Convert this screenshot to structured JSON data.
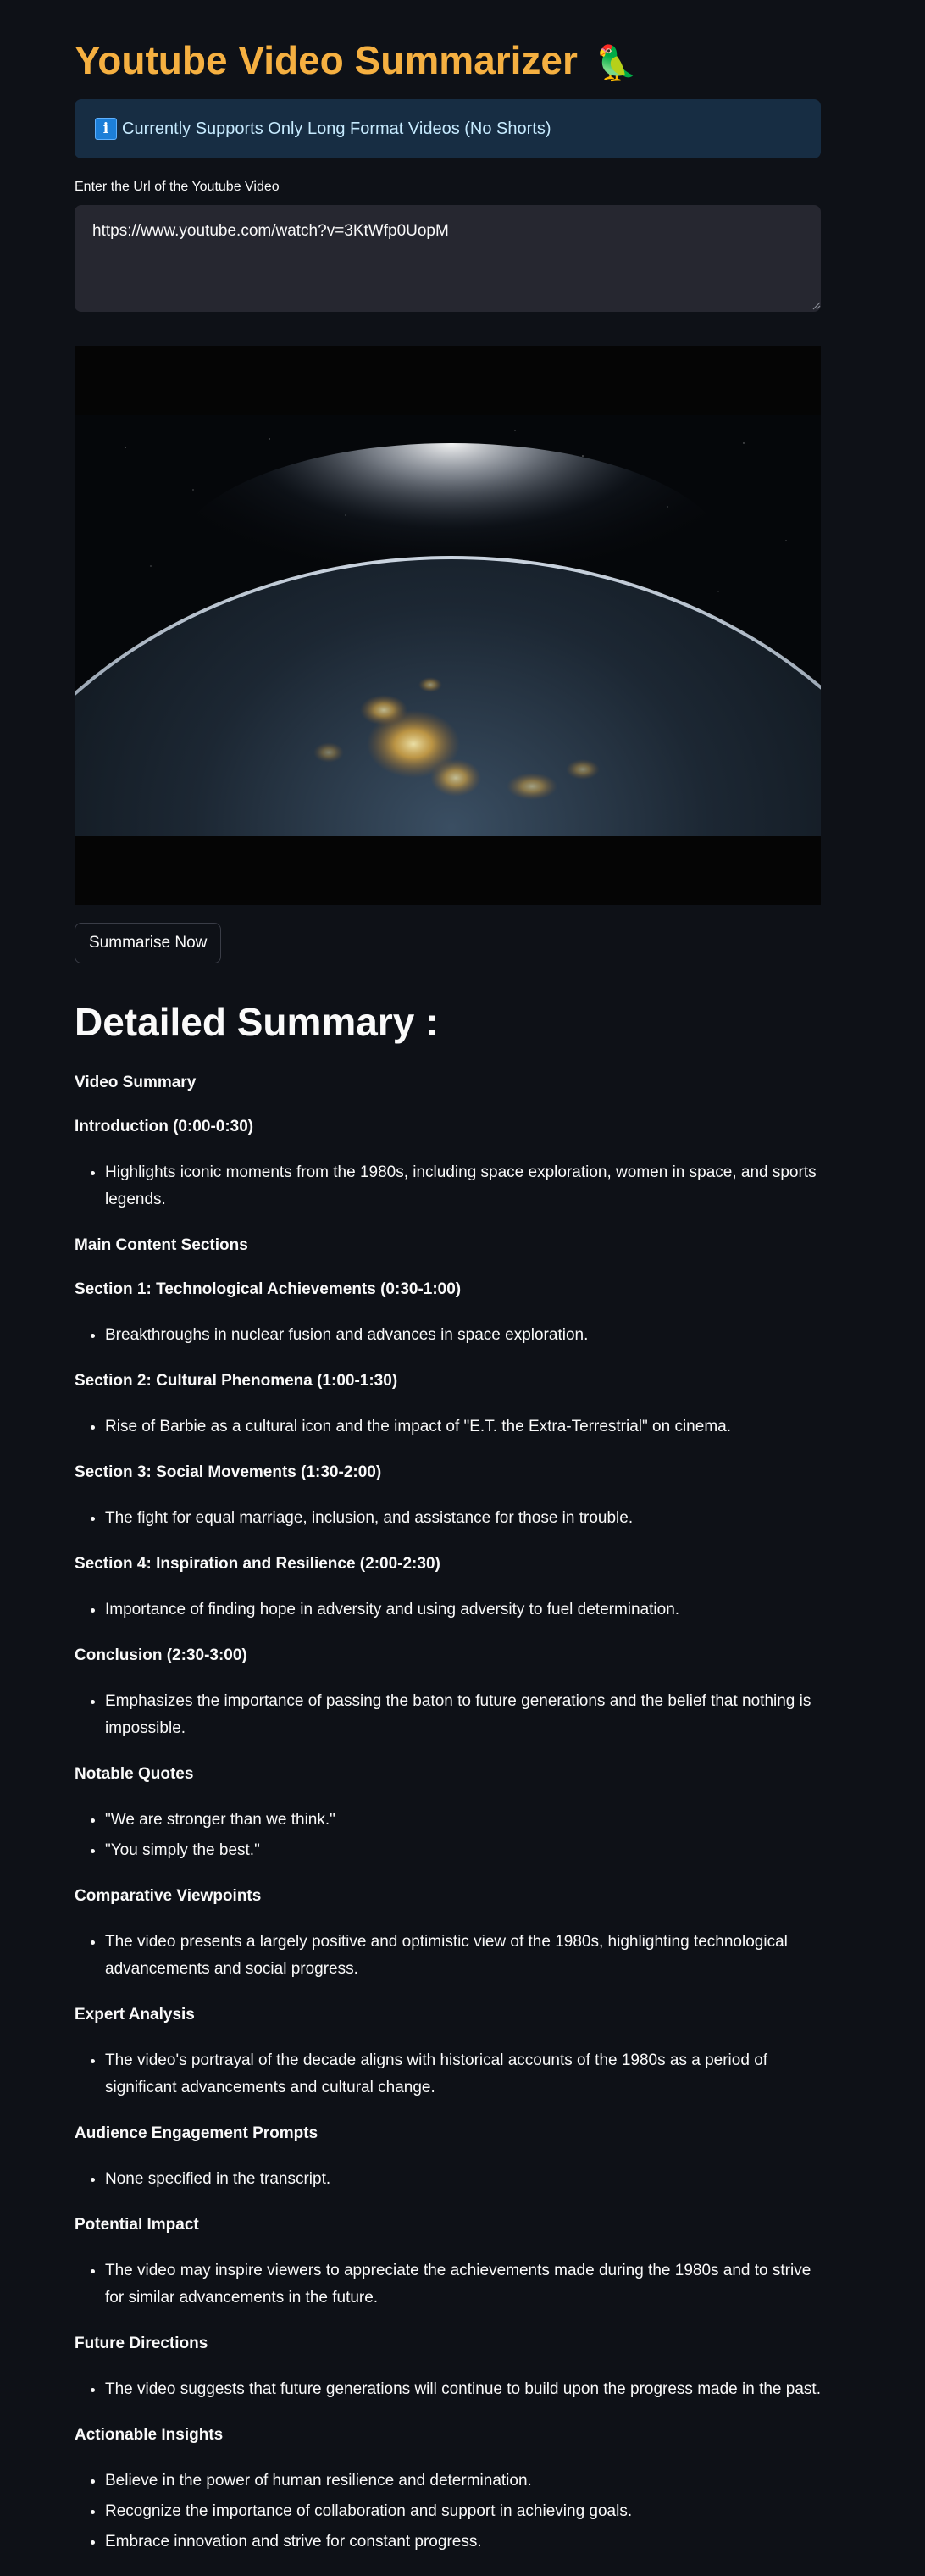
{
  "app": {
    "title": "Youtube Video Summarizer",
    "title_emoji": "🦜"
  },
  "info": {
    "icon": "info-icon",
    "message": "Currently Supports Only Long Format Videos (No Shorts)"
  },
  "url_field": {
    "label": "Enter the Url of the Youtube Video",
    "value": "https://www.youtube.com/watch?v=3KtWfp0UopM"
  },
  "video": {
    "thumbnail": "earth-from-space-at-night"
  },
  "actions": {
    "summarise_label": "Summarise Now"
  },
  "summary": {
    "heading": "Detailed Summary :",
    "sections": [
      {
        "title": "Video Summary",
        "items": []
      },
      {
        "title": "Introduction (0:00-0:30)",
        "items": [
          "Highlights iconic moments from the 1980s, including space exploration, women in space, and sports legends."
        ]
      },
      {
        "title": "Main Content Sections",
        "items": []
      },
      {
        "title": "Section 1: Technological Achievements (0:30-1:00)",
        "items": [
          "Breakthroughs in nuclear fusion and advances in space exploration."
        ]
      },
      {
        "title": "Section 2: Cultural Phenomena (1:00-1:30)",
        "items": [
          "Rise of Barbie as a cultural icon and the impact of \"E.T. the Extra-Terrestrial\" on cinema."
        ]
      },
      {
        "title": "Section 3: Social Movements (1:30-2:00)",
        "items": [
          "The fight for equal marriage, inclusion, and assistance for those in trouble."
        ]
      },
      {
        "title": "Section 4: Inspiration and Resilience (2:00-2:30)",
        "items": [
          "Importance of finding hope in adversity and using adversity to fuel determination."
        ]
      },
      {
        "title": "Conclusion (2:30-3:00)",
        "items": [
          "Emphasizes the importance of passing the baton to future generations and the belief that nothing is impossible."
        ]
      },
      {
        "title": "Notable Quotes",
        "items": [
          "\"We are stronger than we think.\"",
          "\"You simply the best.\""
        ]
      },
      {
        "title": "Comparative Viewpoints",
        "items": [
          "The video presents a largely positive and optimistic view of the 1980s, highlighting technological advancements and social progress."
        ]
      },
      {
        "title": "Expert Analysis",
        "items": [
          "The video's portrayal of the decade aligns with historical accounts of the 1980s as a period of significant advancements and cultural change."
        ]
      },
      {
        "title": "Audience Engagement Prompts",
        "items": [
          "None specified in the transcript."
        ]
      },
      {
        "title": "Potential Impact",
        "items": [
          "The video may inspire viewers to appreciate the achievements made during the 1980s and to strive for similar advancements in the future."
        ]
      },
      {
        "title": "Future Directions",
        "items": [
          "The video suggests that future generations will continue to build upon the progress made in the past."
        ]
      },
      {
        "title": "Actionable Insights",
        "items": [
          "Believe in the power of human resilience and determination.",
          "Recognize the importance of collaboration and support in achieving goals.",
          "Embrace innovation and strive for constant progress."
        ]
      }
    ]
  },
  "colors": {
    "background": "#0e1117",
    "title": "#f5b041",
    "info_bg": "#172d43",
    "info_text": "#c7ebff",
    "input_bg": "#262730"
  }
}
